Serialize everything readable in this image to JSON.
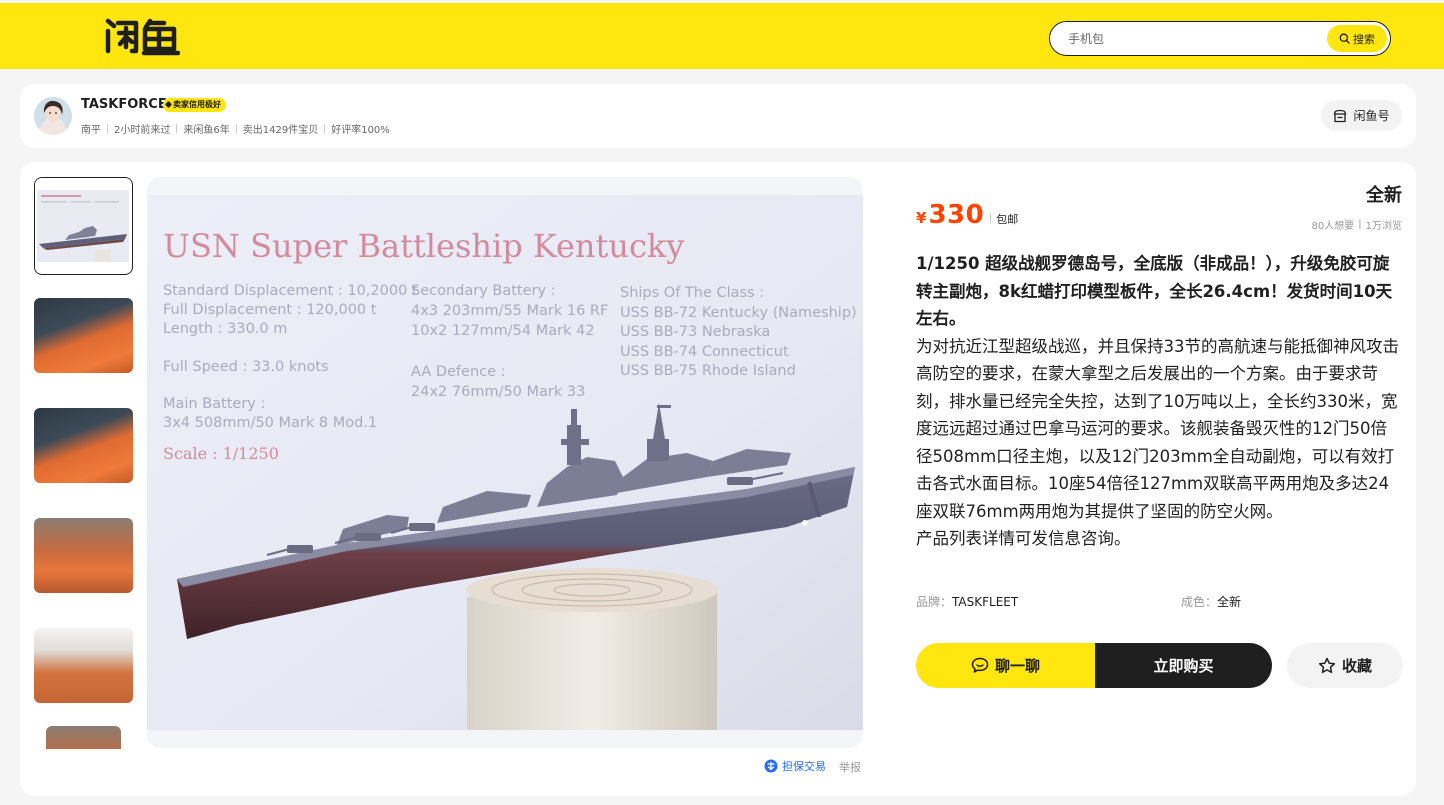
{
  "header": {
    "logo_text": "闲鱼",
    "search": {
      "placeholder": "手机包",
      "button_label": "搜索"
    }
  },
  "seller": {
    "name": "TASKFORCE",
    "credit_badge": "卖家信用极好",
    "meta": [
      "南平",
      "2小时前来过",
      "来闲鱼6年",
      "卖出1429件宝贝",
      "好评率100%"
    ],
    "xianyu_id_label": "闲鱼号"
  },
  "gallery": {
    "thumbnails": [
      "thumb-1",
      "thumb-2",
      "thumb-3",
      "thumb-4",
      "thumb-5",
      "thumb-6"
    ],
    "active_index": 0,
    "photo": {
      "title": "USN Super Battleship Kentucky",
      "col1": [
        "Standard Displacement : 10,2000 t",
        "Full Displacement : 120,000 t",
        "Length : 330.0 m",
        "Full Speed : 33.0 knots",
        "Main Battery :",
        "3x4 508mm/50 Mark 8 Mod.1"
      ],
      "col2": [
        "Secondary Battery :",
        "4x3 203mm/55 Mark 16 RF",
        "10x2 127mm/54 Mark 42",
        "AA Defence :",
        "24x2 76mm/50 Mark 33"
      ],
      "col3": [
        "Ships Of The Class :",
        "USS BB-72 Kentucky (Nameship)",
        "USS BB-73 Nebraska",
        "USS BB-74 Connecticut",
        "USS BB-75 Rhode Island"
      ],
      "scale": "Scale : 1/1250"
    }
  },
  "guarantee_label": "担保交易",
  "report_label": "举报",
  "product": {
    "condition_tag": "全新",
    "currency": "¥",
    "price": "330",
    "shipping": "包邮",
    "wants": "80人想要",
    "views": "1万浏览",
    "description": [
      "1/1250 超级战舰罗德岛号，全底版（非成品！），升级免胶可旋转主副炮，8k红蜡打印模型板件，全长26.4cm！发货时间10天左右。",
      "为对抗近江型超级战巡，并且保持33节的高航速与能抵御神风攻击高防空的要求，在蒙大拿型之后发展出的一个方案。由于要求苛刻，排水量已经完全失控，达到了10万吨以上，全长约330米，宽度远远超过通过巴拿马运河的要求。该舰装备毁灭性的12门50倍径508mm口径主炮，以及12门203mm全自动副炮，可以有效打击各式水面目标。10座54倍径127mm双联高平两用炮及多达24座双联76mm两用炮为其提供了坚固的防空火网。",
      "产品列表详情可发信息咨询。"
    ],
    "brand_label": "品牌：",
    "brand_value": "TASKFLEET",
    "condition_label": "成色：",
    "condition_value": "全新"
  },
  "actions": {
    "chat": "聊一聊",
    "buy": "立即购买",
    "favorite": "收藏"
  },
  "colors": {
    "brand_yellow": "#ffe60f",
    "price_orange": "#ff4400",
    "dark": "#1f1f1f",
    "link_blue": "#2a6cf0"
  }
}
